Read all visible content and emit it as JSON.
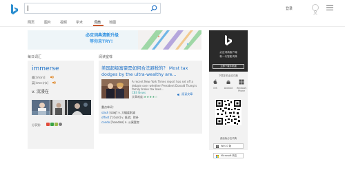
{
  "header": {
    "search_value": "",
    "login": "登录",
    "logo": "bing-logo-icon",
    "menu_icon": "hamburger-menu-icon"
  },
  "tabs": [
    {
      "label": "网页"
    },
    {
      "label": "图片"
    },
    {
      "label": "视频"
    },
    {
      "label": "学术"
    },
    {
      "label": "词典",
      "active": true
    },
    {
      "label": "地图"
    }
  ],
  "ad": {
    "line1": "必应词典清新升级",
    "line2": "等你来TRY!"
  },
  "daily_word": {
    "section_title": "每日词汇",
    "word": "immerse",
    "pron_us": "美[ɪ'mɜrs]",
    "pron_uk": "英[ɪ'mɜ:(r)s]",
    "definition": "v. 沉浸在",
    "share_label": "分享到:"
  },
  "reading": {
    "section_title": "阅读室荐",
    "title": "美国超级富豪是如何合法避税的？ Most tax dodges by the ultra-wealthy are...",
    "snippet": "A recent New York Times report has set off a debate over whether President Donald Trump's family broke tax laws...",
    "source": "CBS News",
    "read_more": "阅读文章",
    "difficulty_label": "文章难度:",
    "stars": "★★★★☆",
    "vocab_title": "重点单词：",
    "vocab": [
      {
        "word": "slash",
        "pron": "[slæʃ]",
        "meaning": "v. 大幅度削减"
      },
      {
        "word": "offset",
        "pron": "['ɔf,set]",
        "meaning": "v. 抵消；弥补"
      },
      {
        "word": "condo",
        "pron": "['kɒndəʊ]",
        "meaning": "n. 公寓套房"
      }
    ]
  },
  "sidebar": {
    "app_line1": "必应词典客户端",
    "app_line2": "新一代智能词典",
    "download_button": "立即下载手机版",
    "download_label": "下载手机必应词典",
    "os": [
      {
        "label": "iOS",
        "icon": "apple-icon"
      },
      {
        "label": "Android",
        "icon": "android-icon"
      },
      {
        "label": "Windows Phone",
        "icon": "windows-phone-icon"
      }
    ],
    "desktop_label": "桌面版必应词典",
    "win10": "Win10 版",
    "store": "Microsoft 商店"
  }
}
